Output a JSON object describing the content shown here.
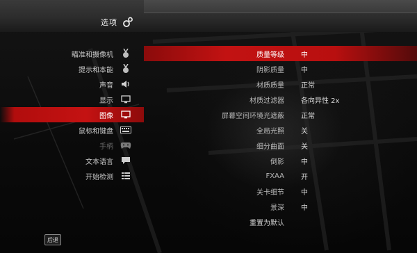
{
  "header": {
    "title": "选项",
    "icon": "settings-gears-icon"
  },
  "sidebar": {
    "items": [
      {
        "label": "瞄准和摄像机",
        "icon": "medal-icon",
        "state": "normal"
      },
      {
        "label": "提示和本能",
        "icon": "medal-icon",
        "state": "normal"
      },
      {
        "label": "声音",
        "icon": "speaker-icon",
        "state": "normal"
      },
      {
        "label": "显示",
        "icon": "monitor-icon",
        "state": "normal"
      },
      {
        "label": "图像",
        "icon": "monitor-icon",
        "state": "active"
      },
      {
        "label": "鼠标和键盘",
        "icon": "keyboard-icon",
        "state": "normal"
      },
      {
        "label": "手柄",
        "icon": "gamepad-icon",
        "state": "disabled"
      },
      {
        "label": "文本语言",
        "icon": "speech-bubble-icon",
        "state": "normal"
      },
      {
        "label": "开始检测",
        "icon": "checklist-icon",
        "state": "normal"
      }
    ]
  },
  "settings": {
    "rows": [
      {
        "label": "质量等级",
        "value": "中"
      },
      {
        "label": "阴影质量",
        "value": "中"
      },
      {
        "label": "材质质量",
        "value": "正常"
      },
      {
        "label": "材质过滤器",
        "value": "各向异性 2x"
      },
      {
        "label": "屏幕空间环境光遮蔽",
        "value": "正常"
      },
      {
        "label": "全局光照",
        "value": "关"
      },
      {
        "label": "细分曲面",
        "value": "关"
      },
      {
        "label": "倒影",
        "value": "中"
      },
      {
        "label": "FXAA",
        "value": "开"
      },
      {
        "label": "关卡细节",
        "value": "中"
      },
      {
        "label": "景深",
        "value": "中"
      }
    ],
    "reset_label": "重置为默认"
  },
  "footer": {
    "back_label": "后退"
  },
  "colors": {
    "accent": "#c41212",
    "text": "#cfcfcf",
    "background": "#0b0b0b"
  }
}
